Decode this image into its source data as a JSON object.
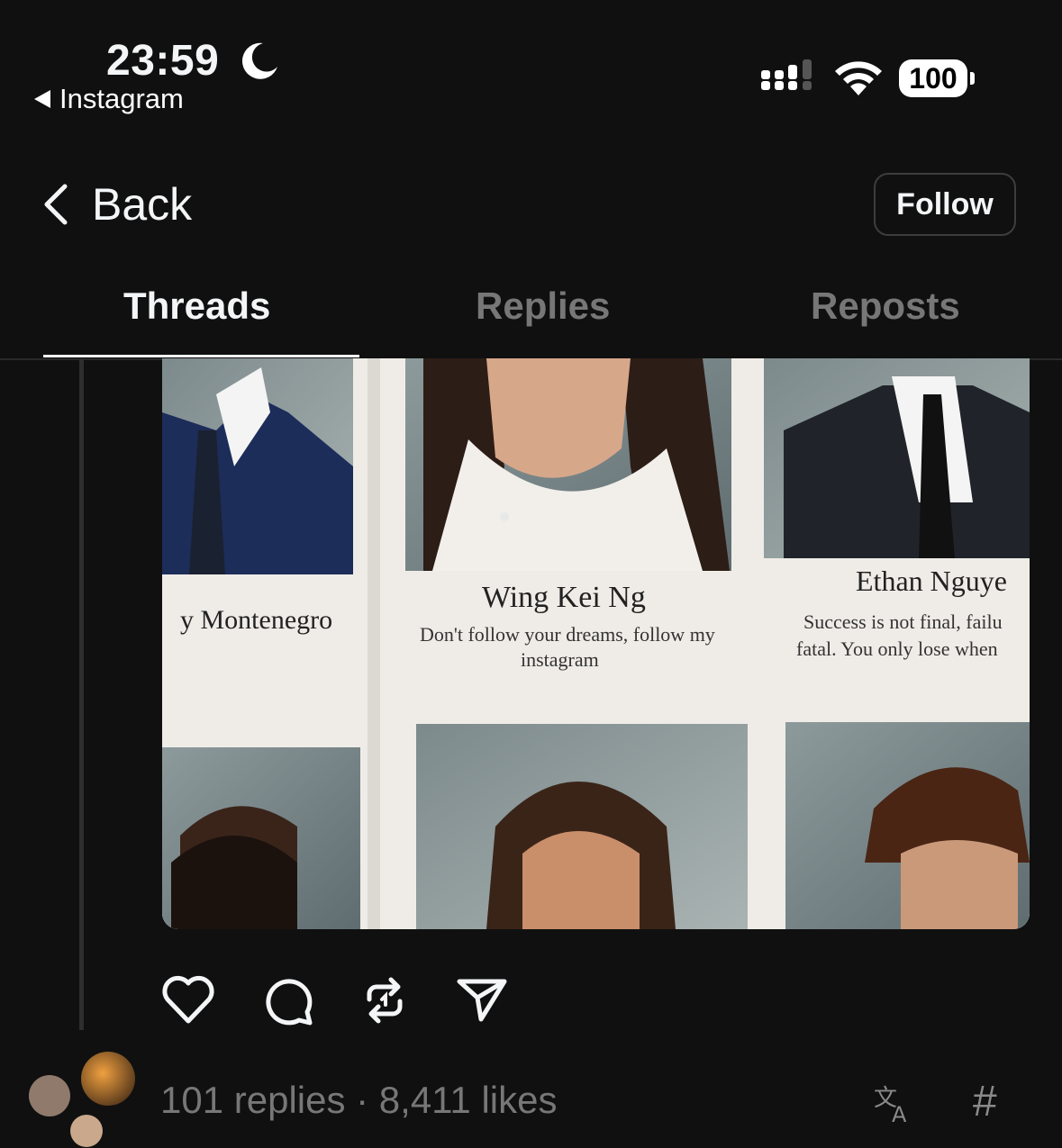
{
  "status_bar": {
    "time": "23:59",
    "back_app": "Instagram",
    "battery": "100"
  },
  "nav": {
    "back_label": "Back",
    "follow_label": "Follow"
  },
  "tabs": [
    {
      "label": "Threads",
      "active": true
    },
    {
      "label": "Replies",
      "active": false
    },
    {
      "label": "Reposts",
      "active": false
    }
  ],
  "post_image": {
    "cards": [
      {
        "name": "y Montenegro"
      },
      {
        "name": "Wing Kei Ng",
        "quote_line1": "Don't follow your dreams, follow my",
        "quote_line2": "instagram"
      },
      {
        "name": "Ethan Nguye",
        "quote_line1": "Success is not final, failu",
        "quote_line2": "fatal. You only lose when"
      }
    ]
  },
  "actions": [
    "heart-icon",
    "comment-icon",
    "repost-icon",
    "share-icon"
  ],
  "footer": {
    "stats": "101 replies · 8,411 likes",
    "hash": "#"
  },
  "colors": {
    "background": "#101010",
    "text_primary": "#f3f5f7",
    "text_secondary": "#777777"
  }
}
